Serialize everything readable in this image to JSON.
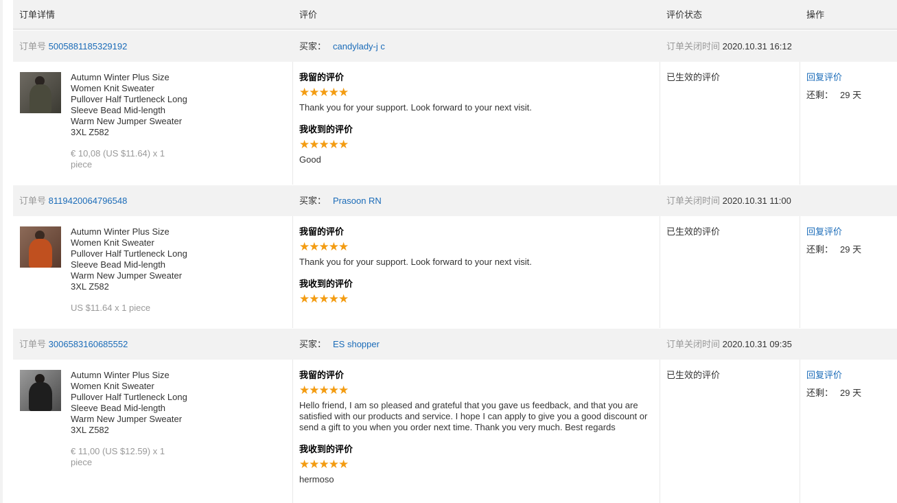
{
  "header": {
    "col_order": "订单详情",
    "col_review": "评价",
    "col_status": "评价状态",
    "col_ops": "操作"
  },
  "labels": {
    "order_no": "订单号",
    "buyer": "买家：",
    "close_time": "订单关闭时间",
    "my_review": "我留的评价",
    "received_review": "我收到的评价",
    "reply": "回复评价",
    "remaining": "还剩：",
    "stars": "★★★★★"
  },
  "orders": [
    {
      "order_no": "5005881185329192",
      "buyer": "candylady-j c",
      "close_time": "2020.10.31 16:12",
      "product_title": "Autumn Winter Plus Size Women Knit Sweater Pullover Half Turtleneck Long Sleeve Bead Mid-length Warm New Jumper Sweater 3XL Z582",
      "price": "€ 10,08 (US $11.64) x 1 piece",
      "my_review_text": "Thank you for your support. Look forward to your next visit.",
      "received_review_text": "Good",
      "status": "已生效的评价",
      "days_left": "29 天",
      "my_rating": 5,
      "received_rating": 5,
      "thumb_color": "#3b3a32"
    },
    {
      "order_no": "8119420064796548",
      "buyer": "Prasoon RN",
      "close_time": "2020.10.31 11:00",
      "product_title": "Autumn Winter Plus Size Women Knit Sweater Pullover Half Turtleneck Long Sleeve Bead Mid-length Warm New Jumper Sweater 3XL Z582",
      "price": "US $11.64 x 1 piece",
      "my_review_text": "Thank you for your support. Look forward to your next visit.",
      "received_review_text": "",
      "status": "已生效的评价",
      "days_left": "29 天",
      "my_rating": 5,
      "received_rating": 5,
      "thumb_color": "#b8471f"
    },
    {
      "order_no": "3006583160685552",
      "buyer": "ES shopper",
      "close_time": "2020.10.31 09:35",
      "product_title": "Autumn Winter Plus Size Women Knit Sweater Pullover Half Turtleneck Long Sleeve Bead Mid-length Warm New Jumper Sweater 3XL Z582",
      "price": "€ 11,00 (US $12.59) x 1 piece",
      "my_review_text": "Hello friend, I am so pleased and grateful that you gave us feedback, and that you are satisfied with our products and service. I hope I can apply to give you a good discount or send a gift to you when you order next time. Thank you very much. Best regards",
      "received_review_text": "hermoso",
      "status": "已生效的评价",
      "days_left": "29 天",
      "my_rating": 5,
      "received_rating": 5,
      "thumb_color": "#1e1e1e"
    }
  ]
}
